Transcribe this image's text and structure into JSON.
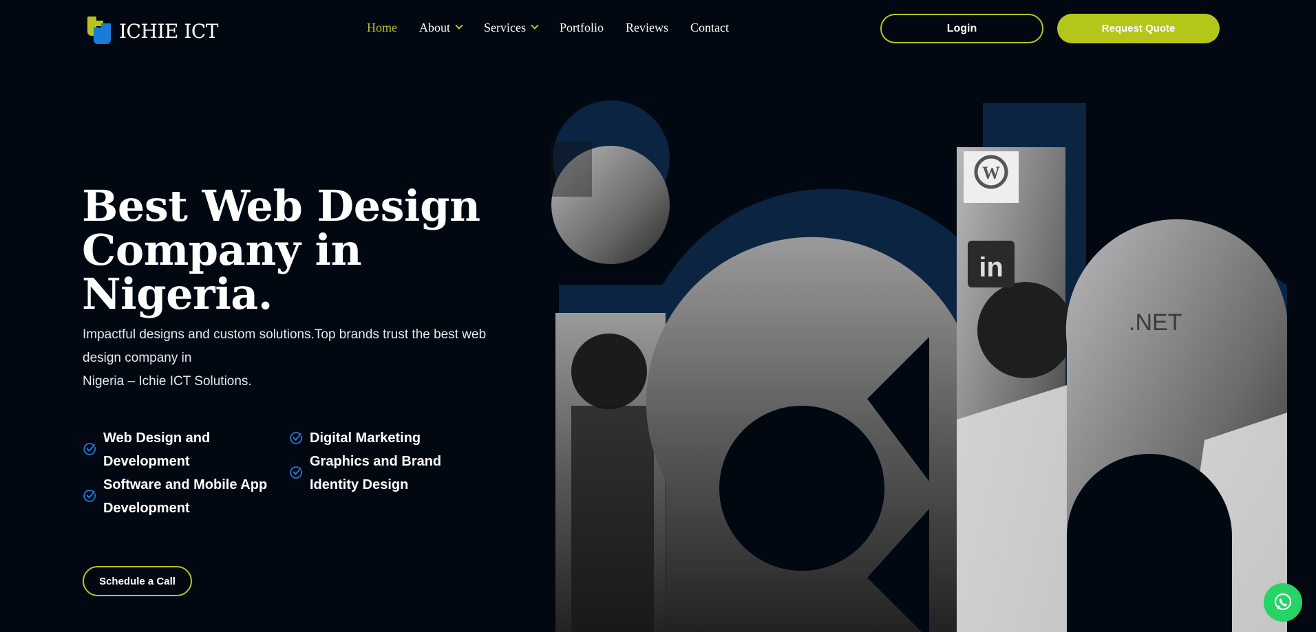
{
  "header": {
    "logo_text": "ICHIE ICT",
    "nav": [
      {
        "label": "Home",
        "active": true,
        "has_dropdown": false
      },
      {
        "label": "About",
        "active": false,
        "has_dropdown": true
      },
      {
        "label": "Services",
        "active": false,
        "has_dropdown": true
      },
      {
        "label": "Portfolio",
        "active": false,
        "has_dropdown": false
      },
      {
        "label": "Reviews",
        "active": false,
        "has_dropdown": false
      },
      {
        "label": "Contact",
        "active": false,
        "has_dropdown": false
      }
    ],
    "login_label": "Login",
    "quote_label": "Request Quote"
  },
  "hero": {
    "title_line1": "Best Web Design",
    "title_line2": "Company in Nigeria.",
    "desc_line1": "Impactful designs and custom solutions.Top brands trust the best web",
    "desc_line2": "design company in",
    "desc_line3": "Nigeria – Ichie ICT Solutions.",
    "features": [
      "Web Design and Development",
      "Digital Marketing",
      "Graphics and Brand Identity Design",
      "Software and Mobile App Development"
    ],
    "cta_label": "Schedule a Call",
    "image_signs": {
      "wp": "W",
      "linkedin": "in",
      "net": ".NET"
    }
  },
  "icons": {
    "dropdown": "chevron-down-icon",
    "feature": "check-circle-icon",
    "chat": "whatsapp-icon"
  },
  "colors": {
    "background": "#020812",
    "accent": "#b5c61a",
    "brand_blue": "#1a7bd9",
    "shape_navy": "#0b2442",
    "whatsapp": "#25d366"
  }
}
